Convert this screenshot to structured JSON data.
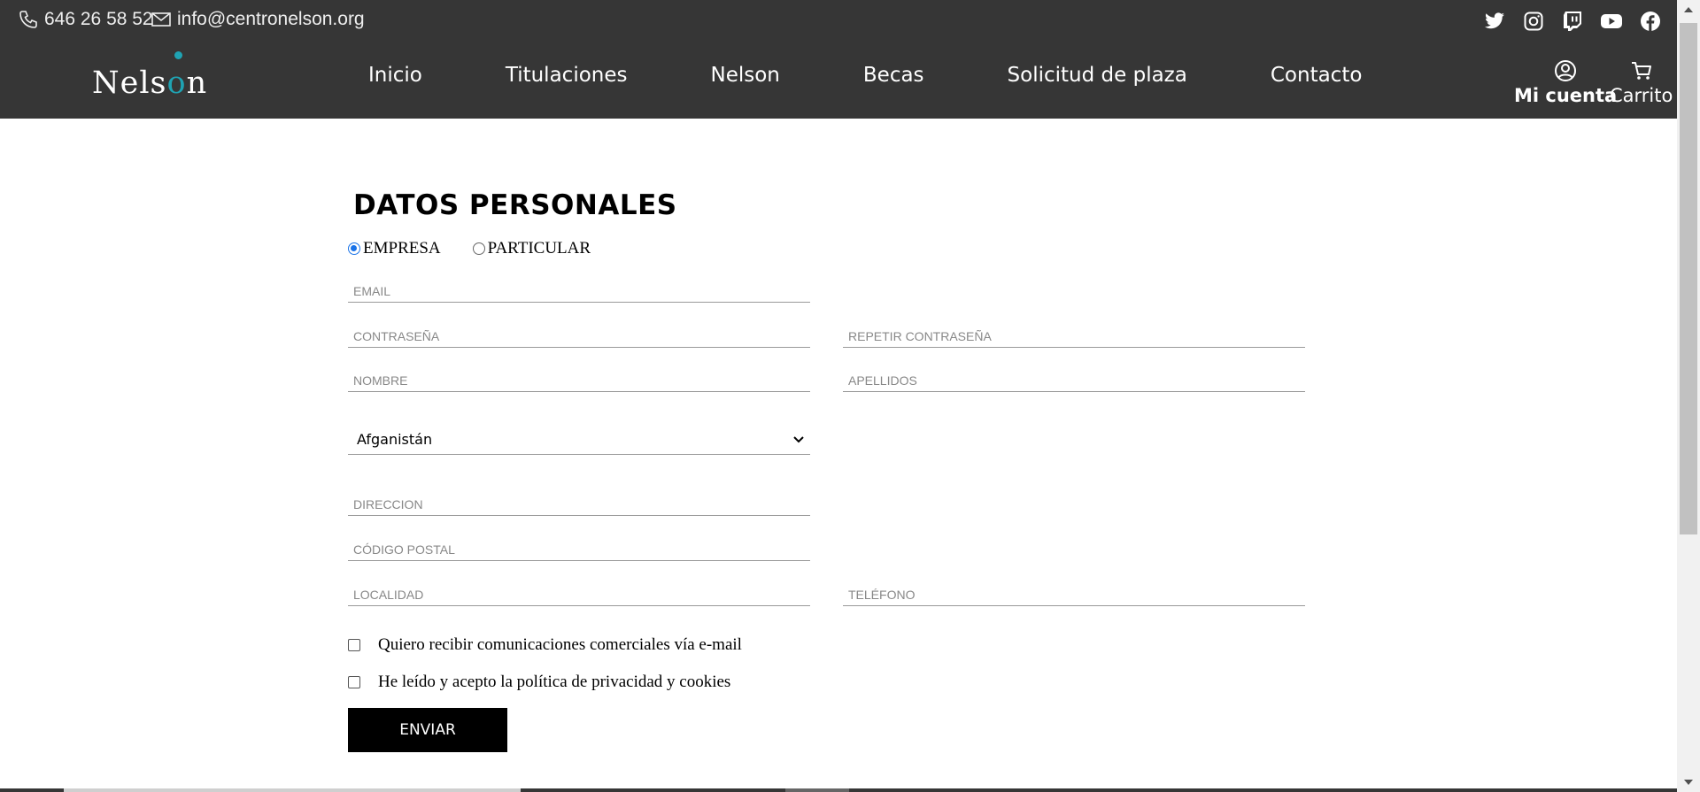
{
  "header": {
    "phone": "646 26 58 52",
    "email": "info@centronelson.org",
    "logo_text": "Nelson",
    "nav": [
      "Inicio",
      "Titulaciones",
      "Nelson",
      "Becas",
      "Solicitud de plaza",
      "Contacto"
    ],
    "account_label": "Mi cuenta",
    "cart_label": "Carrito",
    "social_icons": [
      "twitter-icon",
      "instagram-icon",
      "twitch-icon",
      "youtube-icon",
      "facebook-icon"
    ]
  },
  "form": {
    "title": "DATOS PERSONALES",
    "radio_options": [
      {
        "label": "EMPRESA",
        "selected": true
      },
      {
        "label": "PARTICULAR",
        "selected": false
      }
    ],
    "placeholders": {
      "email": "EMAIL",
      "password": "CONTRASEÑA",
      "repeat_password": "REPETIR CONTRASEÑA",
      "name": "NOMBRE",
      "surname": "APELLIDOS",
      "address": "DIRECCION",
      "postal_code": "CÓDIGO POSTAL",
      "locality": "LOCALIDAD",
      "phone": "TELÉFONO"
    },
    "country_selected": "Afganistán",
    "checkbox_marketing": "Quiero recibir comunicaciones comerciales vía e-mail",
    "checkbox_privacy": "He leído y acepto la política de privacidad y cookies",
    "submit_label": "ENVIAR"
  },
  "colors": {
    "header_bg": "#363636",
    "accent": "#1fa3b3",
    "radio_selected": "#1a73e8"
  }
}
